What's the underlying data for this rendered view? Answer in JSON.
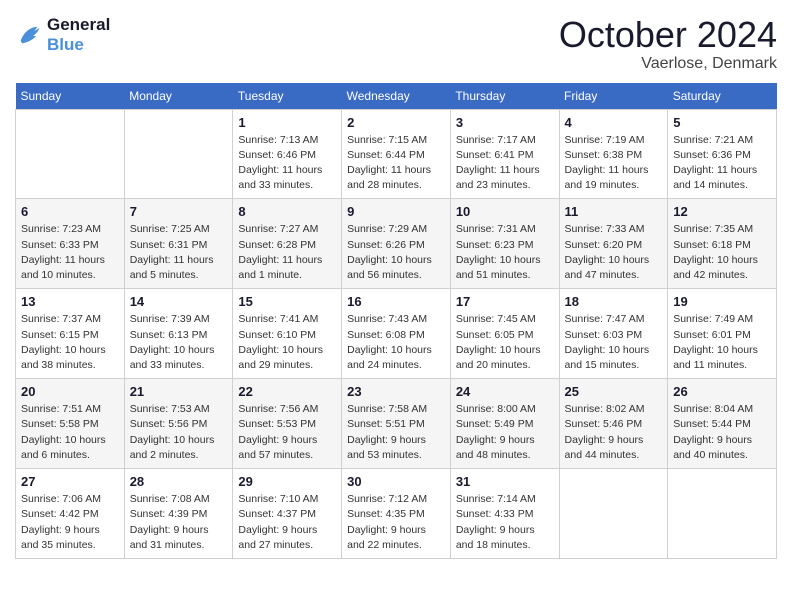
{
  "header": {
    "logo": {
      "line1": "General",
      "line2": "Blue"
    },
    "title": "October 2024",
    "location": "Vaerlose, Denmark"
  },
  "weekdays": [
    "Sunday",
    "Monday",
    "Tuesday",
    "Wednesday",
    "Thursday",
    "Friday",
    "Saturday"
  ],
  "weeks": [
    [
      {
        "day": null
      },
      {
        "day": null
      },
      {
        "day": "1",
        "sunrise": "Sunrise: 7:13 AM",
        "sunset": "Sunset: 6:46 PM",
        "daylight": "Daylight: 11 hours and 33 minutes."
      },
      {
        "day": "2",
        "sunrise": "Sunrise: 7:15 AM",
        "sunset": "Sunset: 6:44 PM",
        "daylight": "Daylight: 11 hours and 28 minutes."
      },
      {
        "day": "3",
        "sunrise": "Sunrise: 7:17 AM",
        "sunset": "Sunset: 6:41 PM",
        "daylight": "Daylight: 11 hours and 23 minutes."
      },
      {
        "day": "4",
        "sunrise": "Sunrise: 7:19 AM",
        "sunset": "Sunset: 6:38 PM",
        "daylight": "Daylight: 11 hours and 19 minutes."
      },
      {
        "day": "5",
        "sunrise": "Sunrise: 7:21 AM",
        "sunset": "Sunset: 6:36 PM",
        "daylight": "Daylight: 11 hours and 14 minutes."
      }
    ],
    [
      {
        "day": "6",
        "sunrise": "Sunrise: 7:23 AM",
        "sunset": "Sunset: 6:33 PM",
        "daylight": "Daylight: 11 hours and 10 minutes."
      },
      {
        "day": "7",
        "sunrise": "Sunrise: 7:25 AM",
        "sunset": "Sunset: 6:31 PM",
        "daylight": "Daylight: 11 hours and 5 minutes."
      },
      {
        "day": "8",
        "sunrise": "Sunrise: 7:27 AM",
        "sunset": "Sunset: 6:28 PM",
        "daylight": "Daylight: 11 hours and 1 minute."
      },
      {
        "day": "9",
        "sunrise": "Sunrise: 7:29 AM",
        "sunset": "Sunset: 6:26 PM",
        "daylight": "Daylight: 10 hours and 56 minutes."
      },
      {
        "day": "10",
        "sunrise": "Sunrise: 7:31 AM",
        "sunset": "Sunset: 6:23 PM",
        "daylight": "Daylight: 10 hours and 51 minutes."
      },
      {
        "day": "11",
        "sunrise": "Sunrise: 7:33 AM",
        "sunset": "Sunset: 6:20 PM",
        "daylight": "Daylight: 10 hours and 47 minutes."
      },
      {
        "day": "12",
        "sunrise": "Sunrise: 7:35 AM",
        "sunset": "Sunset: 6:18 PM",
        "daylight": "Daylight: 10 hours and 42 minutes."
      }
    ],
    [
      {
        "day": "13",
        "sunrise": "Sunrise: 7:37 AM",
        "sunset": "Sunset: 6:15 PM",
        "daylight": "Daylight: 10 hours and 38 minutes."
      },
      {
        "day": "14",
        "sunrise": "Sunrise: 7:39 AM",
        "sunset": "Sunset: 6:13 PM",
        "daylight": "Daylight: 10 hours and 33 minutes."
      },
      {
        "day": "15",
        "sunrise": "Sunrise: 7:41 AM",
        "sunset": "Sunset: 6:10 PM",
        "daylight": "Daylight: 10 hours and 29 minutes."
      },
      {
        "day": "16",
        "sunrise": "Sunrise: 7:43 AM",
        "sunset": "Sunset: 6:08 PM",
        "daylight": "Daylight: 10 hours and 24 minutes."
      },
      {
        "day": "17",
        "sunrise": "Sunrise: 7:45 AM",
        "sunset": "Sunset: 6:05 PM",
        "daylight": "Daylight: 10 hours and 20 minutes."
      },
      {
        "day": "18",
        "sunrise": "Sunrise: 7:47 AM",
        "sunset": "Sunset: 6:03 PM",
        "daylight": "Daylight: 10 hours and 15 minutes."
      },
      {
        "day": "19",
        "sunrise": "Sunrise: 7:49 AM",
        "sunset": "Sunset: 6:01 PM",
        "daylight": "Daylight: 10 hours and 11 minutes."
      }
    ],
    [
      {
        "day": "20",
        "sunrise": "Sunrise: 7:51 AM",
        "sunset": "Sunset: 5:58 PM",
        "daylight": "Daylight: 10 hours and 6 minutes."
      },
      {
        "day": "21",
        "sunrise": "Sunrise: 7:53 AM",
        "sunset": "Sunset: 5:56 PM",
        "daylight": "Daylight: 10 hours and 2 minutes."
      },
      {
        "day": "22",
        "sunrise": "Sunrise: 7:56 AM",
        "sunset": "Sunset: 5:53 PM",
        "daylight": "Daylight: 9 hours and 57 minutes."
      },
      {
        "day": "23",
        "sunrise": "Sunrise: 7:58 AM",
        "sunset": "Sunset: 5:51 PM",
        "daylight": "Daylight: 9 hours and 53 minutes."
      },
      {
        "day": "24",
        "sunrise": "Sunrise: 8:00 AM",
        "sunset": "Sunset: 5:49 PM",
        "daylight": "Daylight: 9 hours and 48 minutes."
      },
      {
        "day": "25",
        "sunrise": "Sunrise: 8:02 AM",
        "sunset": "Sunset: 5:46 PM",
        "daylight": "Daylight: 9 hours and 44 minutes."
      },
      {
        "day": "26",
        "sunrise": "Sunrise: 8:04 AM",
        "sunset": "Sunset: 5:44 PM",
        "daylight": "Daylight: 9 hours and 40 minutes."
      }
    ],
    [
      {
        "day": "27",
        "sunrise": "Sunrise: 7:06 AM",
        "sunset": "Sunset: 4:42 PM",
        "daylight": "Daylight: 9 hours and 35 minutes."
      },
      {
        "day": "28",
        "sunrise": "Sunrise: 7:08 AM",
        "sunset": "Sunset: 4:39 PM",
        "daylight": "Daylight: 9 hours and 31 minutes."
      },
      {
        "day": "29",
        "sunrise": "Sunrise: 7:10 AM",
        "sunset": "Sunset: 4:37 PM",
        "daylight": "Daylight: 9 hours and 27 minutes."
      },
      {
        "day": "30",
        "sunrise": "Sunrise: 7:12 AM",
        "sunset": "Sunset: 4:35 PM",
        "daylight": "Daylight: 9 hours and 22 minutes."
      },
      {
        "day": "31",
        "sunrise": "Sunrise: 7:14 AM",
        "sunset": "Sunset: 4:33 PM",
        "daylight": "Daylight: 9 hours and 18 minutes."
      },
      {
        "day": null
      },
      {
        "day": null
      }
    ]
  ]
}
